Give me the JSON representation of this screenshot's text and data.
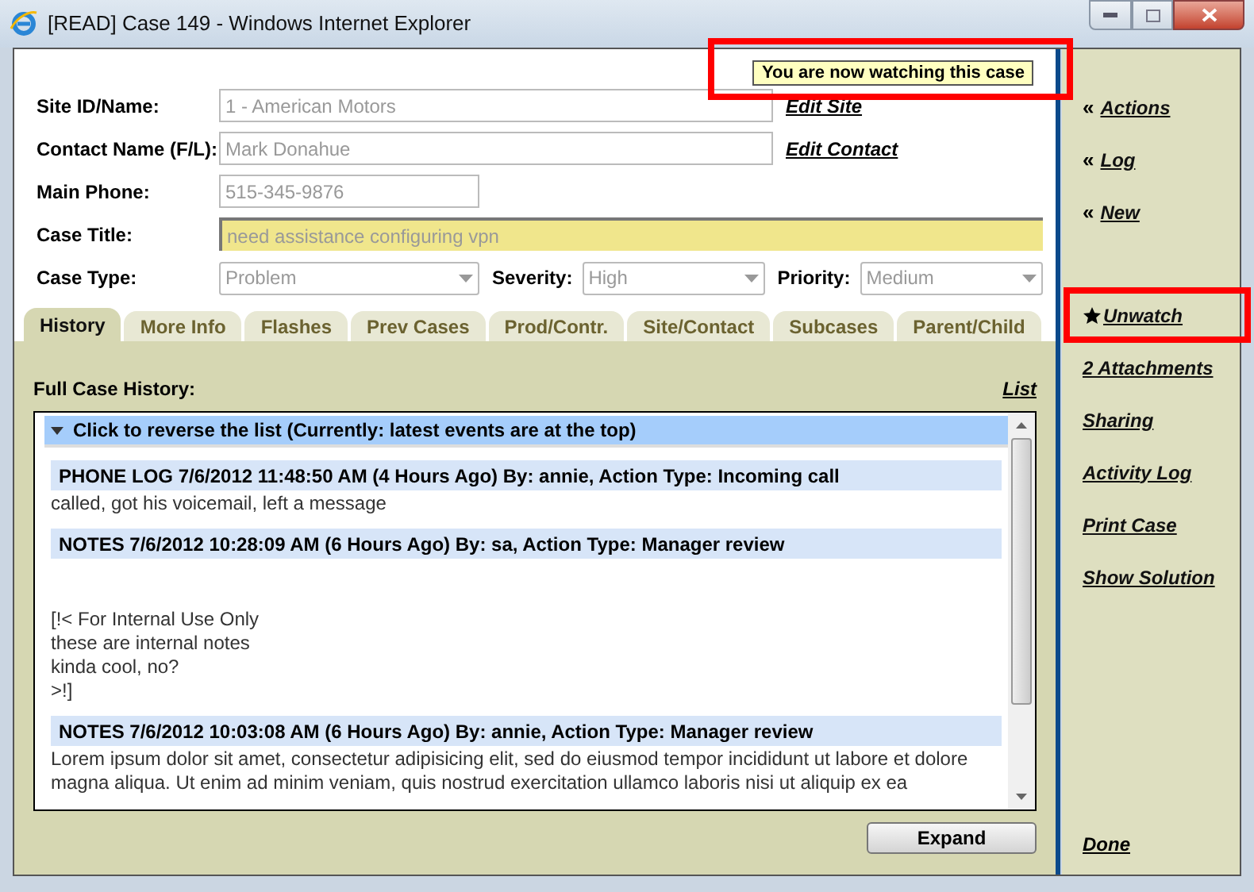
{
  "window": {
    "title": "[READ] Case 149 - Windows Internet Explorer"
  },
  "notice": {
    "text": "You are now watching this case",
    "highlighted": true
  },
  "fields": [
    {
      "label": "Site ID/Name:",
      "value": "1 - American Motors",
      "kind": "wide",
      "link": "Edit Site"
    },
    {
      "label": "Contact Name (F/L):",
      "value": "Mark Donahue",
      "kind": "wide",
      "link": "Edit Contact"
    },
    {
      "label": "Main Phone:",
      "value": "515-345-9876",
      "kind": "short"
    },
    {
      "label": "Case Title:",
      "value": "need assistance configuring vpn",
      "kind": "title"
    }
  ],
  "selects": [
    {
      "label": "Case Type:",
      "value": "Problem"
    },
    {
      "label": "Severity:",
      "value": "High"
    },
    {
      "label": "Priority:",
      "value": "Medium"
    }
  ],
  "tabs": [
    {
      "label": "History",
      "selected": true
    },
    {
      "label": "More Info",
      "selected": false
    },
    {
      "label": "Flashes",
      "selected": false
    },
    {
      "label": "Prev Cases",
      "selected": false
    },
    {
      "label": "Prod/Contr.",
      "selected": false
    },
    {
      "label": "Site/Contact",
      "selected": false
    },
    {
      "label": "Subcases",
      "selected": false
    },
    {
      "label": "Parent/Child",
      "selected": false
    }
  ],
  "history": {
    "heading": "Full Case History:",
    "list_link": "List",
    "reverse_bar": "Click to reverse the list (Currently: latest events are at the top)",
    "entries": [
      {
        "header": "PHONE LOG 7/6/2012 11:48:50 AM (4 Hours Ago) By: annie, Action Type: Incoming call",
        "spaced": false,
        "lines": [
          "called, got his voicemail, left a message"
        ]
      },
      {
        "header": "NOTES 7/6/2012 10:28:09 AM (6 Hours Ago) By: sa, Action Type: Manager review",
        "spaced": true,
        "lines": [
          "[!< For Internal Use Only",
          "these are internal notes",
          "kinda cool, no?",
          ">!]"
        ]
      },
      {
        "header": "NOTES 7/6/2012 10:03:08 AM (6 Hours Ago) By: annie, Action Type: Manager review",
        "spaced": false,
        "lines": [
          "Lorem ipsum dolor sit amet, consectetur adipisicing elit, sed do eiusmod tempor incididunt ut labore et dolore magna aliqua. Ut enim ad minim veniam, quis nostrud exercitation ullamco laboris nisi ut aliquip ex ea"
        ]
      }
    ],
    "expand_button": "Expand"
  },
  "sidebar": {
    "groups": [
      [
        {
          "prefix": "«",
          "label": "Actions",
          "kind": "menu",
          "highlighted": false
        },
        {
          "prefix": "«",
          "label": "Log",
          "kind": "menu",
          "highlighted": false
        },
        {
          "prefix": "«",
          "label": "New",
          "kind": "menu",
          "highlighted": false
        }
      ],
      [
        {
          "label": "Unwatch",
          "kind": "watch",
          "highlighted": true
        },
        {
          "label": "2 Attachments",
          "kind": "link",
          "highlighted": false
        },
        {
          "label": "Sharing",
          "kind": "link",
          "highlighted": false
        },
        {
          "label": "Activity Log",
          "kind": "link",
          "highlighted": false
        },
        {
          "label": "Print Case",
          "kind": "link",
          "highlighted": false
        },
        {
          "label": "Show Solution",
          "kind": "link",
          "highlighted": false
        }
      ]
    ],
    "done": "Done"
  }
}
